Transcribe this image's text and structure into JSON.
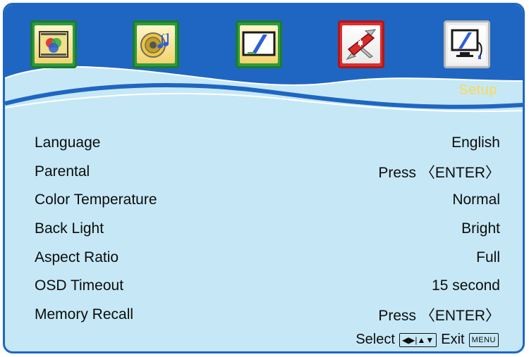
{
  "menu": {
    "active_tab_title": "Setup",
    "tabs": [
      {
        "icon": "picture-rgb-icon"
      },
      {
        "icon": "audio-speaker-icon"
      },
      {
        "icon": "screen-icon"
      },
      {
        "icon": "tools-knife-icon"
      },
      {
        "icon": "setup-monitor-icon"
      }
    ]
  },
  "settings": [
    {
      "label": "Language",
      "value": "English"
    },
    {
      "label": "Parental",
      "value": "Press 〈ENTER〉"
    },
    {
      "label": "Color Temperature",
      "value": "Normal"
    },
    {
      "label": "Back Light",
      "value": "Bright"
    },
    {
      "label": "Aspect Ratio",
      "value": "Full"
    },
    {
      "label": "OSD Timeout",
      "value": "15 second"
    },
    {
      "label": "Memory Recall",
      "value": "Press 〈ENTER〉"
    }
  ],
  "footer": {
    "select_label": "Select",
    "select_keys": "◀▶|▲▼",
    "exit_label": "Exit",
    "exit_key": "MENU"
  },
  "colors": {
    "frame_border": "#1f66c2",
    "background": "#c6e8f6",
    "header_band": "#1f66c2",
    "active_title": "#ffd94a"
  }
}
